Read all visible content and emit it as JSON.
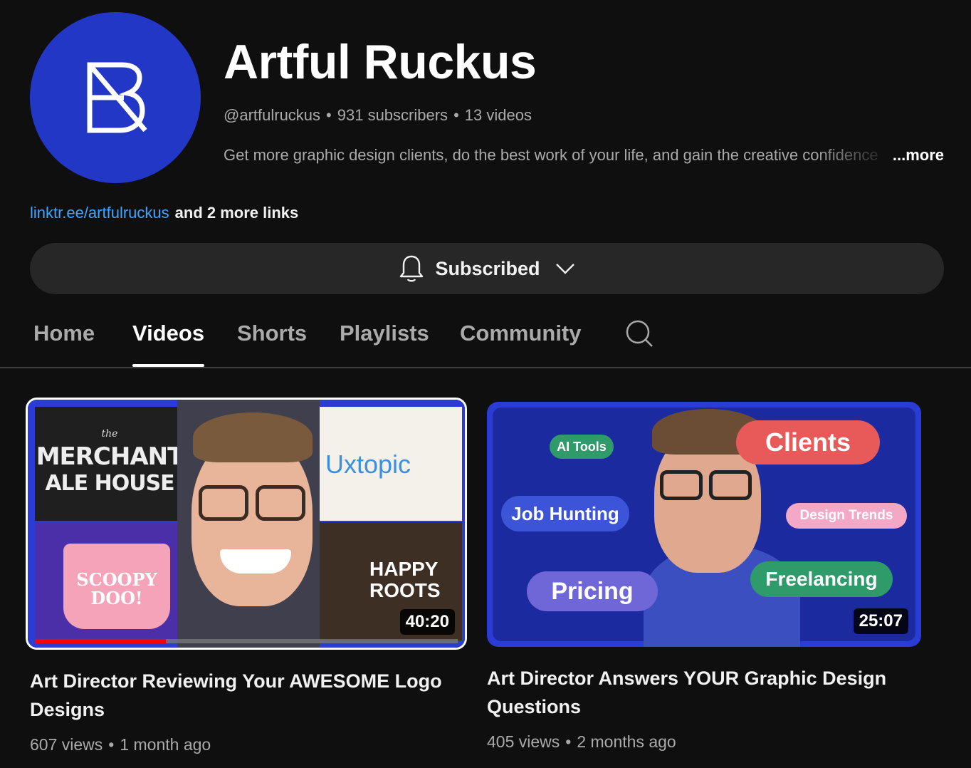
{
  "channel": {
    "name": "Artful Ruckus",
    "handle": "@artfulruckus",
    "subscribers": "931 subscribers",
    "videos_count": "13 videos",
    "separator": "•",
    "description": "Get more graphic design clients, do the best work of your life, and gain the creative confidence",
    "more_label": "...more",
    "avatar_color": "#2337c6"
  },
  "links": {
    "primary": "linktr.ee/artfulruckus",
    "more": "and 2 more links"
  },
  "subscribe": {
    "label": "Subscribed",
    "icon": "bell-icon"
  },
  "tabs": [
    {
      "label": "Home",
      "active": false
    },
    {
      "label": "Videos",
      "active": true
    },
    {
      "label": "Shorts",
      "active": false
    },
    {
      "label": "Playlists",
      "active": false
    },
    {
      "label": "Community",
      "active": false
    }
  ],
  "videos": [
    {
      "title": "Art Director Reviewing Your AWESOME Logo Designs",
      "views": "607 views",
      "age": "1 month ago",
      "duration": "40:20",
      "watched": 0.31,
      "thumb_text": {
        "merchant_top": "the",
        "merchant_1": "MERCHANT",
        "merchant_2": "ALE HOUSE",
        "uxtopic": "Uxtopic",
        "scoopy_1": "SCOOPY",
        "scoopy_2": "DOO!",
        "happy": "HAPPY",
        "roots": "ROOTS"
      }
    },
    {
      "title": "Art Director Answers YOUR Graphic Design Questions",
      "views": "405 views",
      "age": "2 months ago",
      "duration": "25:07",
      "pills": {
        "ai_tools": "AI Tools",
        "clients": "Clients",
        "job_hunting": "Job Hunting",
        "design_trends": "Design Trends",
        "pricing": "Pricing",
        "freelancing": "Freelancing"
      }
    }
  ],
  "colors": {
    "link": "#3ea6ff",
    "background": "#0f0f0f",
    "button_bg": "#272727",
    "progress": "#ff0000"
  }
}
